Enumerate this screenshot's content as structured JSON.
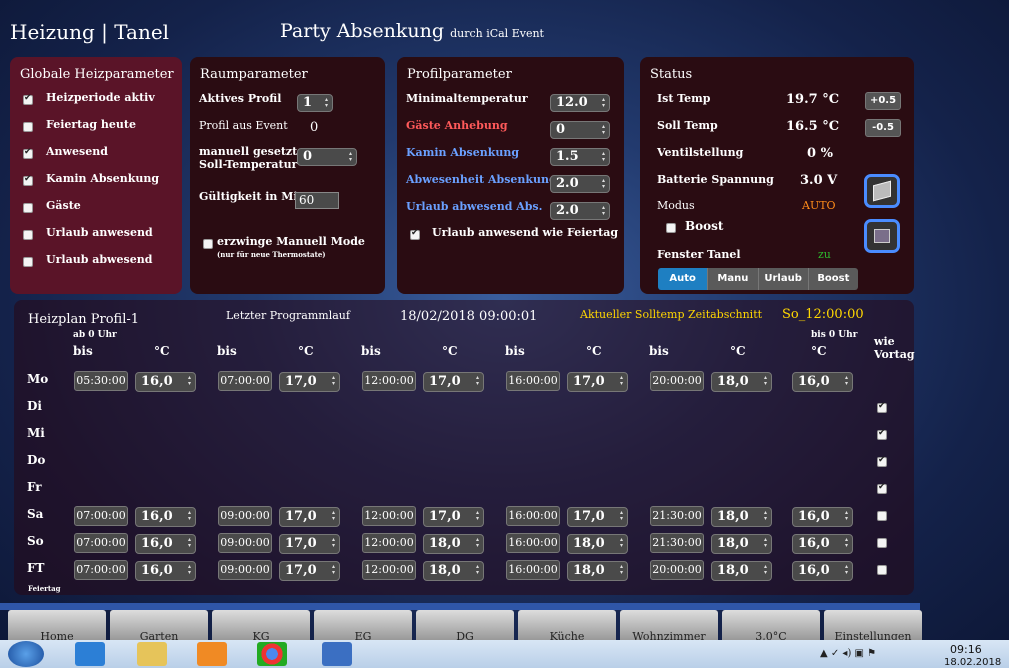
{
  "header": {
    "title": "Heizung | Tanel",
    "party": "Party Absenkung",
    "party_sub": "durch iCal Event"
  },
  "global": {
    "title": "Globale Heizparameter",
    "items": [
      {
        "label": "Heizperiode aktiv",
        "checked": true
      },
      {
        "label": "Feiertag heute",
        "checked": false
      },
      {
        "label": "Anwesend",
        "checked": true
      },
      {
        "label": "Kamin Absenkung",
        "checked": true
      },
      {
        "label": "Gäste",
        "checked": false
      },
      {
        "label": "Urlaub anwesend",
        "checked": false
      },
      {
        "label": "Urlaub abwesend",
        "checked": false
      }
    ]
  },
  "raum": {
    "title": "Raumparameter",
    "aktives_label": "Aktives Profil",
    "aktives_value": "1",
    "event_label": "Profil aus Event",
    "event_value": "0",
    "manuell_label1": "manuell gesetzte",
    "manuell_label2": "Soll-Temperatur",
    "manuell_value": "0",
    "gueltig_label": "Gültigkeit in Min",
    "gueltig_value": "60",
    "force_label": "erzwinge Manuell Mode",
    "force_sub": "(nur für neue Thermostate)"
  },
  "profil": {
    "title": "Profilparameter",
    "rows": [
      {
        "label": "Minimaltemperatur",
        "value": "12.0",
        "color": "#ffffff"
      },
      {
        "label": "Gäste Anhebung",
        "value": "0",
        "color": "#ff5a5a"
      },
      {
        "label": "Kamin Absenkung",
        "value": "1.5",
        "color": "#6aa0ff"
      },
      {
        "label": "Abwesenheit Absenkung",
        "value": "2.0",
        "color": "#6aa0ff"
      },
      {
        "label": "Urlaub abwesend Abs.",
        "value": "2.0",
        "color": "#6aa0ff"
      }
    ],
    "urlaub_label": "Urlaub anwesend wie Feiertag"
  },
  "status": {
    "title": "Status",
    "ist_label": "Ist Temp",
    "ist_value": "19.7 °C",
    "plus": "+0.5",
    "soll_label": "Soll Temp",
    "soll_value": "16.5 °C",
    "minus": "-0.5",
    "ventil_label": "Ventilstellung",
    "ventil_value": "0 %",
    "batt_label": "Batterie Spannung",
    "batt_value": "3.0 V",
    "modus_label": "Modus",
    "modus_value": "AUTO",
    "boost_label": "Boost",
    "fenster_label": "Fenster Tanel",
    "fenster_value": "zu",
    "modes": [
      "Auto",
      "Manu",
      "Urlaub",
      "Boost"
    ]
  },
  "plan": {
    "title": "Heizplan Profil-1",
    "last_label": "Letzter Programmlauf",
    "last_value": "18/02/2018 09:00:01",
    "akt_label": "Aktueller Solltemp Zeitabschnitt",
    "akt_value": "So_12:00:00",
    "ab0": "ab 0 Uhr",
    "bis0": "bis 0 Uhr",
    "bis": "bis",
    "deg": "°C",
    "wie": "wie",
    "vortag": "Vortag",
    "feiertag": "Feiertag",
    "days": [
      {
        "name": "Mo",
        "times": [
          "05:30:00",
          "07:00:00",
          "12:00:00",
          "16:00:00",
          "20:00:00"
        ],
        "temps": [
          "16,0",
          "17,0",
          "17,0",
          "17,0",
          "18,0",
          "16,0"
        ]
      },
      {
        "name": "Di",
        "same": true
      },
      {
        "name": "Mi",
        "same": true
      },
      {
        "name": "Do",
        "same": true
      },
      {
        "name": "Fr",
        "same": true
      },
      {
        "name": "Sa",
        "times": [
          "07:00:00",
          "09:00:00",
          "12:00:00",
          "16:00:00",
          "21:30:00"
        ],
        "temps": [
          "16,0",
          "17,0",
          "17,0",
          "17,0",
          "18,0",
          "16,0"
        ]
      },
      {
        "name": "So",
        "times": [
          "07:00:00",
          "09:00:00",
          "12:00:00",
          "16:00:00",
          "21:30:00"
        ],
        "temps": [
          "16,0",
          "17,0",
          "18,0",
          "18,0",
          "18,0",
          "16,0"
        ]
      },
      {
        "name": "FT",
        "times": [
          "07:00:00",
          "09:00:00",
          "12:00:00",
          "16:00:00",
          "20:00:00"
        ],
        "temps": [
          "16,0",
          "17,0",
          "18,0",
          "18,0",
          "18,0",
          "16,0"
        ]
      }
    ]
  },
  "nav": [
    "Home",
    "Garten",
    "KG",
    "EG",
    "DG",
    "Küche",
    "Wohnzimmer",
    "3,0°C",
    "Einstellungen"
  ],
  "taskbar": {
    "time": "09:16",
    "date": "18.02.2018"
  }
}
